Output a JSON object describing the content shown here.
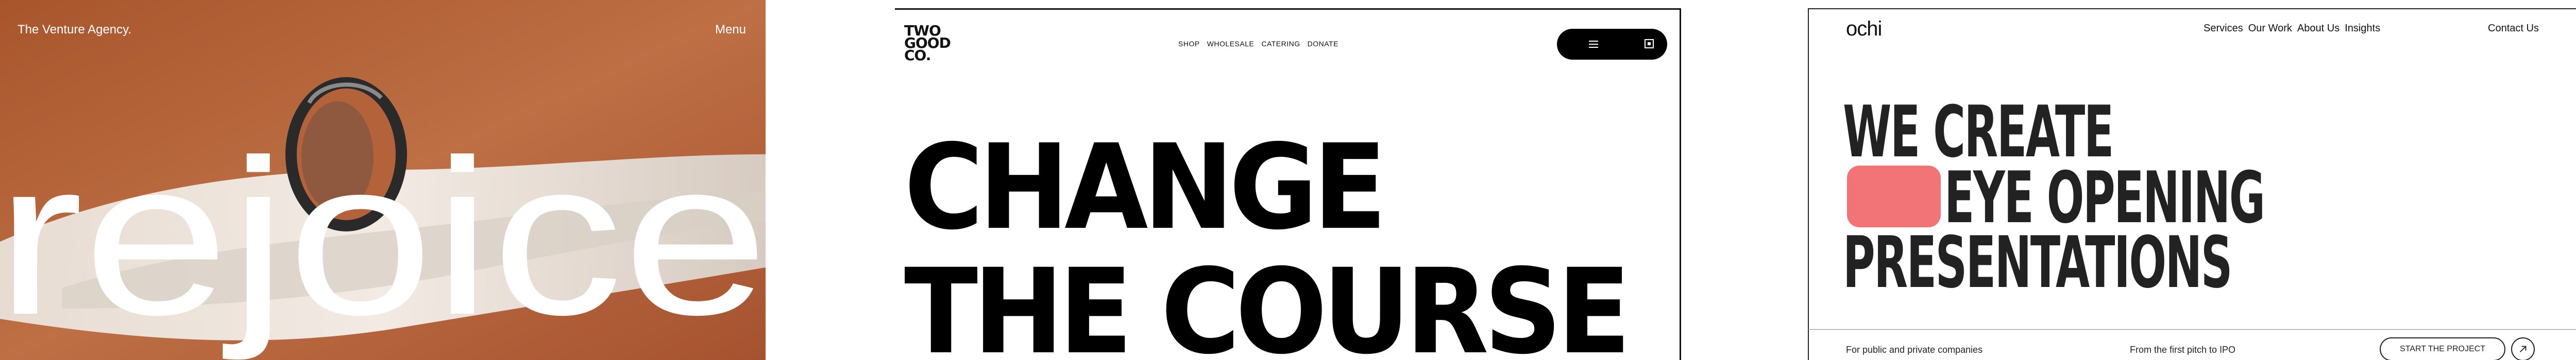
{
  "rejoice": {
    "brand": "The Venture Agency.",
    "menu_label": "Menu",
    "hero_word": "rejoice",
    "colors": {
      "background": "#b5653a",
      "fabric": "#ece7e1",
      "text": "#ffffff"
    }
  },
  "twogood": {
    "logo_lines": [
      "TWO",
      "GOOD",
      "CO."
    ],
    "nav": [
      "SHOP",
      "WHOLESALE",
      "CATERING",
      "DONATE"
    ],
    "icons": {
      "menu": "menu-icon",
      "cart": "cart-icon"
    },
    "headline_line1": "CHANGE",
    "headline_line2": "THE COURSE"
  },
  "ochi": {
    "logo": "ochi",
    "nav": [
      "Services",
      "Our Work",
      "About Us",
      "Insights"
    ],
    "contact": "Contact Us",
    "headline": [
      "WE CREATE",
      "EYE OPENING",
      "PRESENTATIONS"
    ],
    "footer_left": "For public and private companies",
    "footer_mid": "From the first pitch to IPO",
    "cta_label": "START THE PROJECT",
    "colors": {
      "accent": "#f27476"
    }
  }
}
